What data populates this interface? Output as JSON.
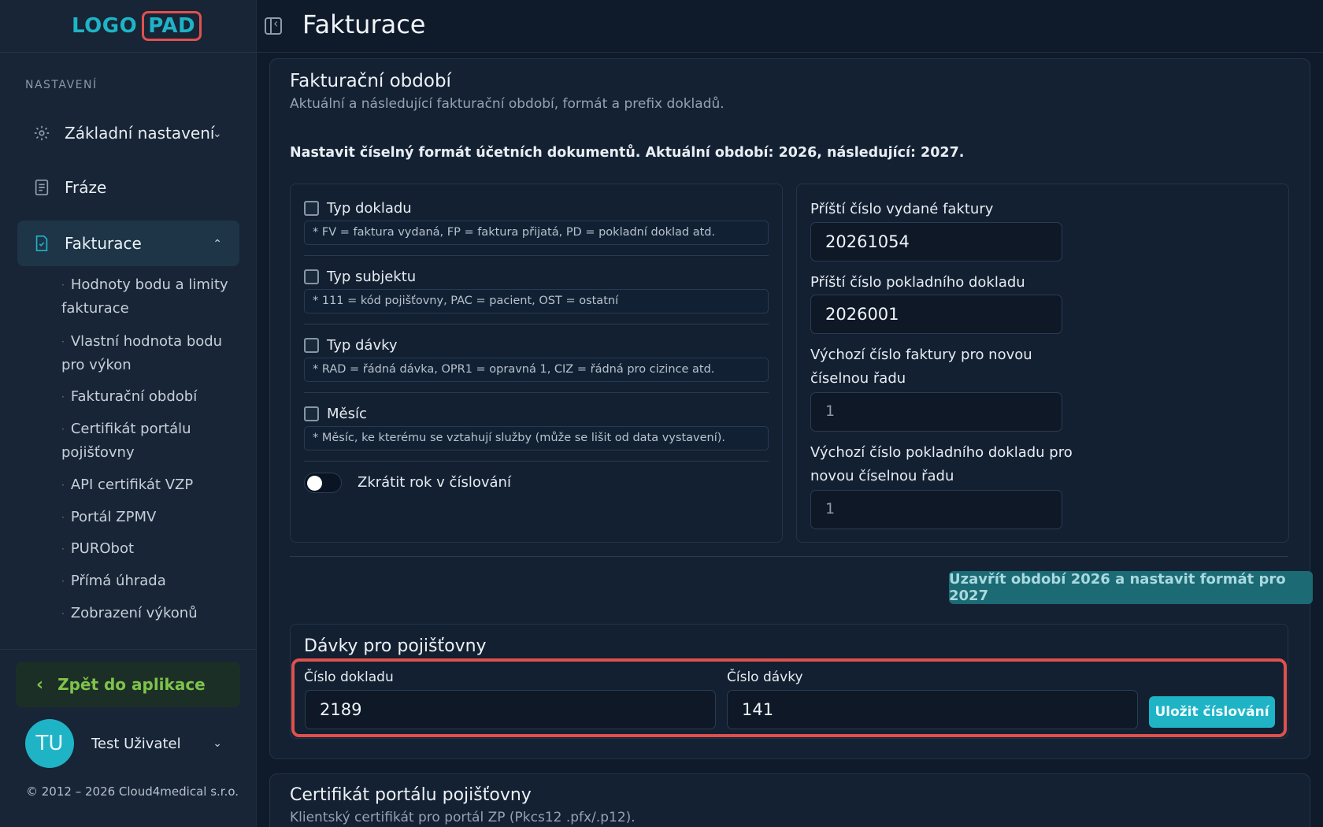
{
  "logo": {
    "part1": "LOGO",
    "part2": "PAD"
  },
  "sidebar": {
    "section_label": "NASTAVENÍ",
    "items": [
      {
        "label": "Základní nastavení",
        "icon": "gear-icon",
        "expanded": false
      },
      {
        "label": "Fráze",
        "icon": "document-icon"
      },
      {
        "label": "Fakturace",
        "icon": "invoice-icon",
        "expanded": true
      }
    ],
    "subitems": [
      "Hodnoty bodu a limity fakturace",
      "Vlastní hodnota bodu pro výkon",
      "Fakturační období",
      "Certifikát portálu pojišťovny",
      "API certifikát VZP",
      "Portál ZPMV",
      "PURObot",
      "Přímá úhrada",
      "Zobrazení výkonů"
    ],
    "back_label": "Zpět do aplikace",
    "user": {
      "initials": "TU",
      "name": "Test Uživatel"
    },
    "copyright": "© 2012 – 2026 Cloud4medical s.r.o."
  },
  "header": {
    "title": "Fakturace"
  },
  "billing_period": {
    "title": "Fakturační období",
    "subtitle": "Aktuální a následující fakturační období, formát a prefix dokladů.",
    "lead": "Nastavit číselný formát účetních dokumentů. Aktuální období: 2026, následující: 2027.",
    "options": [
      {
        "label": "Typ dokladu",
        "hint": "* FV = faktura vydaná, FP = faktura přijatá, PD = pokladní doklad atd.",
        "checked": false
      },
      {
        "label": "Typ subjektu",
        "hint": "* 111 = kód pojišťovny, PAC = pacient, OST = ostatní",
        "checked": false
      },
      {
        "label": "Typ dávky",
        "hint": "* RAD = řádná dávka, OPR1 = opravná 1, CIZ = řádná pro cizince atd.",
        "checked": false
      },
      {
        "label": "Měsíc",
        "hint": "* Měsíc, ke kterému se vztahují služby (může se lišit od data vystavení).",
        "checked": false
      }
    ],
    "toggle_label": "Zkrátit rok v číslování",
    "toggle_on": false,
    "fields": [
      {
        "label": "Příští číslo vydané faktury",
        "value": "20261054"
      },
      {
        "label": "Příští číslo pokladního dokladu",
        "value": "2026001"
      },
      {
        "label_line1": "Výchozí číslo faktury pro novou",
        "label_line2": "číselnou řadu",
        "value": "1"
      },
      {
        "label_line1": "Výchozí číslo pokladního dokladu pro",
        "label_line2": "novou číselnou řadu",
        "value": "1"
      }
    ],
    "close_button": "Uzavřít období 2026 a nastavit formát pro 2027"
  },
  "batches": {
    "title": "Dávky pro pojišťovny",
    "doc_number_label": "Číslo dokladu",
    "doc_number_value": "2189",
    "batch_number_label": "Číslo dávky",
    "batch_number_value": "141",
    "save_button": "Uložit číslování"
  },
  "certificate": {
    "title": "Certifikát portálu pojišťovny",
    "subtitle": "Klientský certifikát pro portál ZP (Pkcs12 .pfx/.p12)."
  },
  "colors": {
    "accent": "#1fb3c6",
    "highlight": "#e0514d",
    "back": "#7fc34a"
  }
}
